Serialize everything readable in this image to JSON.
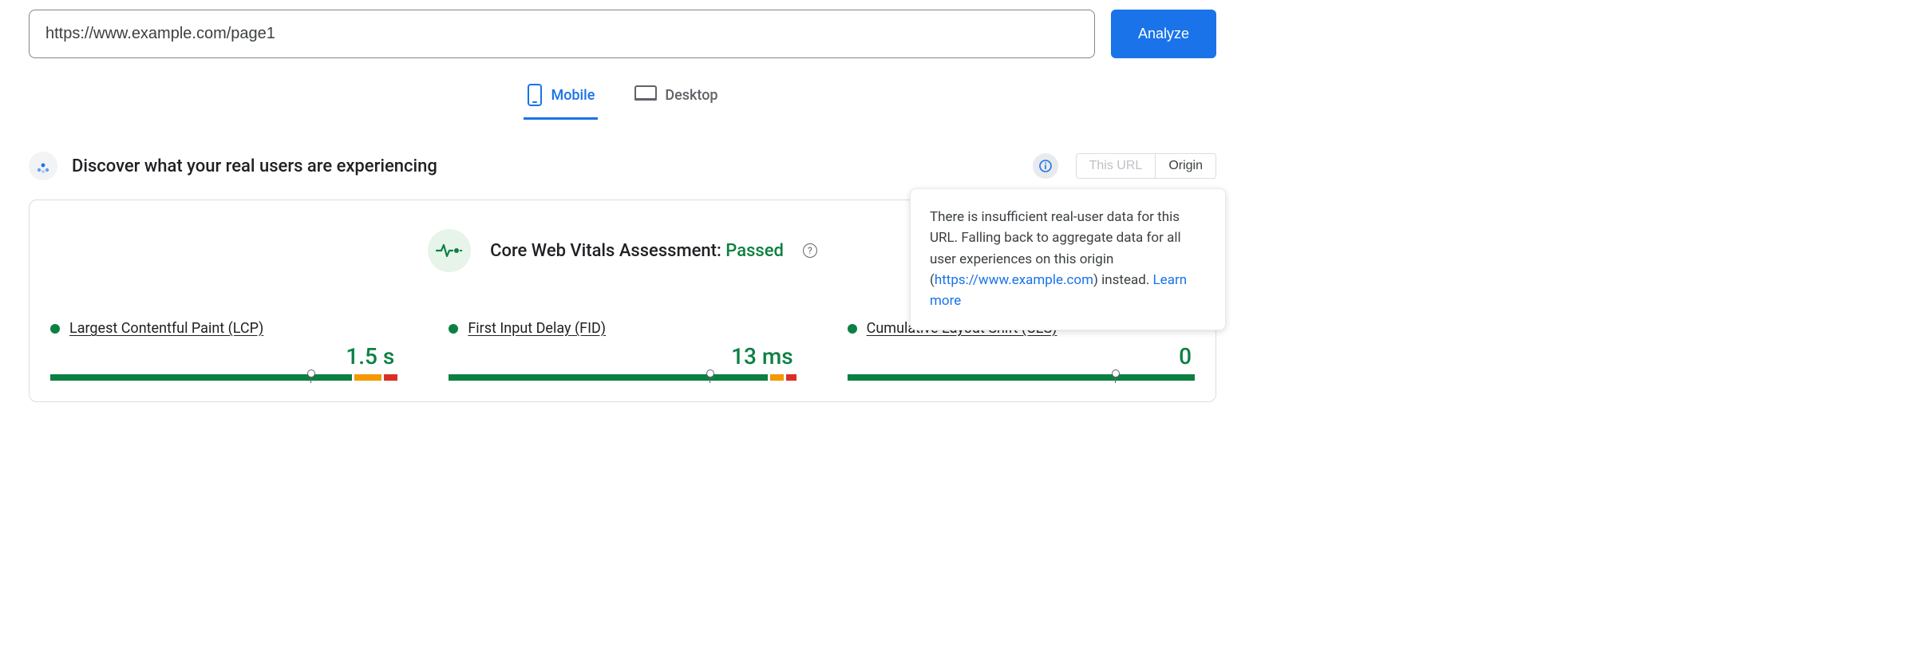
{
  "search": {
    "url_value": "https://www.example.com/page1",
    "analyze_label": "Analyze"
  },
  "tabs": {
    "mobile": "Mobile",
    "desktop": "Desktop"
  },
  "discover": {
    "title": "Discover what your real users are experiencing",
    "scope_this_url": "This URL",
    "scope_origin": "Origin"
  },
  "assessment": {
    "label": "Core Web Vitals Assessment: ",
    "status": "Passed"
  },
  "metrics": {
    "lcp": {
      "name": "Largest Contentful Paint (LCP)",
      "value": "1.5 s"
    },
    "fid": {
      "name": "First Input Delay (FID)",
      "value": "13 ms"
    },
    "cls": {
      "name": "Cumulative Layout Shift (CLS)",
      "value": "0"
    }
  },
  "tooltip": {
    "text_before": "There is insufficient real-user data for this URL. Falling back to aggregate data for all user experiences on this origin (",
    "origin_link": "https://www.example.com",
    "text_after": ") instead. ",
    "learn_more": "Learn more"
  }
}
